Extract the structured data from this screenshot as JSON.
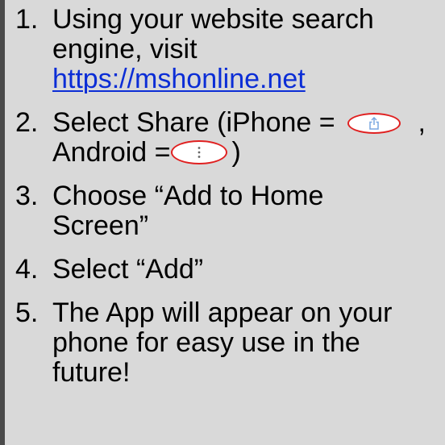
{
  "steps": [
    {
      "number": "1.",
      "lines": [
        "Using your website search",
        "engine, visit"
      ],
      "link": "https://mshonline.net"
    },
    {
      "number": "2.",
      "line1_text": "Select Share (iPhone =",
      "line1_suffix": ",",
      "line2_text": "Android =",
      "line2_suffix": ")",
      "share_icon": "share-icon",
      "menu_icon": "vertical-dots-icon",
      "highlight_color": "#e02020"
    },
    {
      "number": "3.",
      "lines": [
        "Choose “Add to Home",
        "Screen”"
      ]
    },
    {
      "number": "4.",
      "lines": [
        "Select “Add”"
      ]
    },
    {
      "number": "5.",
      "lines": [
        "The App will appear on your",
        "phone for easy use in the",
        "future!"
      ]
    }
  ],
  "colors": {
    "background": "#d9d9d9",
    "link": "#0b2dd6",
    "edge_bar": "#4a4a4a"
  }
}
